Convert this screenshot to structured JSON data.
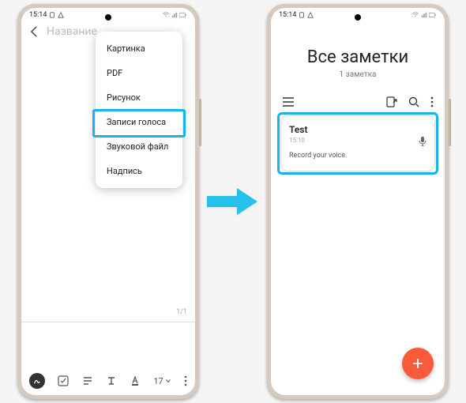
{
  "statusbar": {
    "time": "15:14"
  },
  "screen1": {
    "title_placeholder": "Название",
    "menu": {
      "items": [
        "Картинка",
        "PDF",
        "Рисунок",
        "Записи голоса",
        "Звуковой файл",
        "Надпись"
      ],
      "highlighted_index": 3
    },
    "page_counter": "1/1",
    "toolbar": {
      "font_size": "17"
    }
  },
  "screen2": {
    "header": {
      "title": "Все заметки",
      "subtitle": "1 заметка"
    },
    "note": {
      "title": "Test",
      "time": "15:10",
      "body": "Record your voice."
    }
  },
  "colors": {
    "highlight": "#18b4e9",
    "fab": "#f95b3a"
  }
}
